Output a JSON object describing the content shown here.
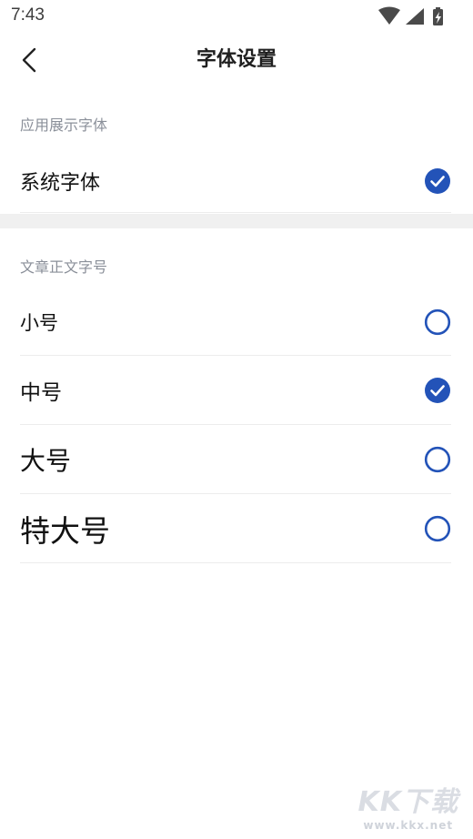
{
  "status_bar": {
    "time": "7:43",
    "icons": [
      "wifi-icon",
      "signal-icon",
      "battery-charging-icon"
    ]
  },
  "header": {
    "title": "字体设置",
    "back_icon": "chevron-left-icon"
  },
  "app_font": {
    "section_label": "应用展示字体",
    "options": [
      {
        "label": "系统字体",
        "selected": true
      }
    ]
  },
  "body_font_size": {
    "section_label": "文章正文字号",
    "options": [
      {
        "label": "小号",
        "selected": false
      },
      {
        "label": "中号",
        "selected": true
      },
      {
        "label": "大号",
        "selected": false
      },
      {
        "label": "特大号",
        "selected": false
      }
    ]
  },
  "watermark": {
    "main": "KK下载",
    "sub": "www.kkx.net"
  },
  "colors": {
    "accent": "#2353b8",
    "section_text": "#8a8f99",
    "divider": "#ececec",
    "band": "#f0f0f0"
  }
}
